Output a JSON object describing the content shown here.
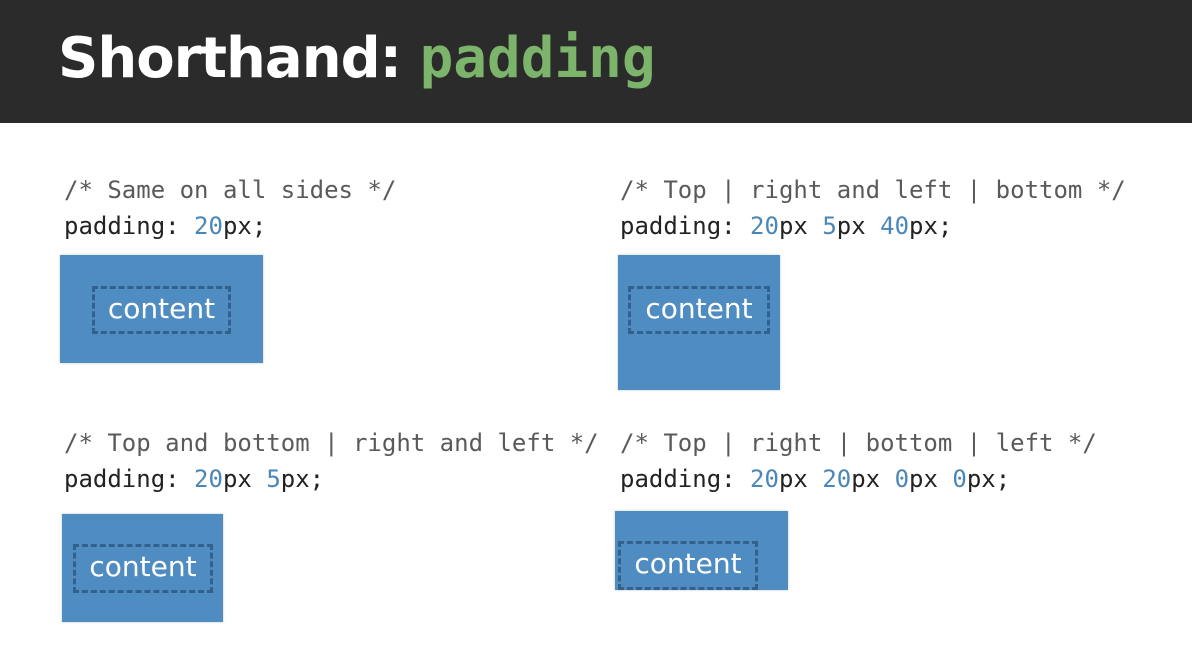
{
  "header": {
    "title_prefix": "Shorthand: ",
    "title_keyword": "padding"
  },
  "examples": [
    {
      "comment": "/* Same on all sides */",
      "prop": "padding: ",
      "values": [
        "20",
        "px;"
      ],
      "content_label": "content"
    },
    {
      "comment": "/* Top | right and left | bottom */",
      "prop": "padding: ",
      "values": [
        "20",
        "px ",
        "5",
        "px ",
        "40",
        "px;"
      ],
      "content_label": "content"
    },
    {
      "comment": "/* Top and bottom | right and left */",
      "prop": "padding: ",
      "values": [
        "20",
        "px ",
        "5",
        "px;"
      ],
      "content_label": "content"
    },
    {
      "comment": "/* Top | right | bottom | left */",
      "prop": "padding: ",
      "values": [
        "20",
        "px ",
        "20",
        "px ",
        "0",
        "px ",
        "0",
        "px;"
      ],
      "content_label": "content"
    }
  ],
  "colors": {
    "header_bg": "#2b2b2b",
    "keyword": "#7cb46c",
    "number": "#4a86b8",
    "box": "#4f8cc2"
  }
}
